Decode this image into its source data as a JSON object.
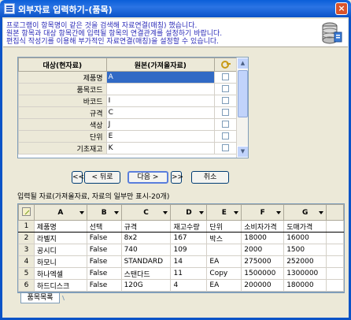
{
  "window": {
    "title": "외부자료 입력하기-(품목)"
  },
  "description": {
    "line1": "프로그램이 항목명이 같은 것을 검색해 자료연결(매칭) 했습니다.",
    "line2": "원본 항목과 대상 항목간에 입력될 항목의 연결관계를 설정하기 바랍니다.",
    "line3": "편집식 작성기를 이용해 부가적인 자료연결(매칭)을 설정할 수 있습니다."
  },
  "mapping": {
    "col_target": "대상(현자료)",
    "col_source": "원본(가져올자료)",
    "rows": [
      {
        "target": "제품명",
        "source": "A",
        "selected": true
      },
      {
        "target": "품목코드",
        "source": "",
        "selected": false
      },
      {
        "target": "바코드",
        "source": "I",
        "selected": false
      },
      {
        "target": "규격",
        "source": "C",
        "selected": false
      },
      {
        "target": "색상",
        "source": "J",
        "selected": false
      },
      {
        "target": "단위",
        "source": "E",
        "selected": false
      },
      {
        "target": "기초재고",
        "source": "K",
        "selected": false
      }
    ]
  },
  "nav": {
    "first": "<<",
    "prev": "< 뒤로",
    "next": "다음 >",
    "last": ">>",
    "cancel": "취소"
  },
  "grid": {
    "caption": "입력될 자료(가져올자료, 자료의 일부만 표시-20개)",
    "columns": [
      "A",
      "B",
      "C",
      "D",
      "E",
      "F",
      "G"
    ],
    "rows": [
      {
        "n": "1",
        "cells": [
          "제품명",
          "선택",
          "규격",
          "재고수량",
          "단위",
          "소비자가격",
          "도매가격"
        ]
      },
      {
        "n": "2",
        "cells": [
          "라벨지",
          "False",
          "8x2",
          "167",
          "박스",
          "18000",
          "16000"
        ]
      },
      {
        "n": "3",
        "cells": [
          "공시디",
          "False",
          "740",
          "109",
          "",
          "2000",
          "1500"
        ]
      },
      {
        "n": "4",
        "cells": [
          "하모니",
          "False",
          "STANDARD",
          "14",
          "EA",
          "275000",
          "252000"
        ]
      },
      {
        "n": "5",
        "cells": [
          "하나엑셀",
          "False",
          "스탠다드",
          "11",
          "Copy",
          "1500000",
          "1300000"
        ]
      },
      {
        "n": "6",
        "cells": [
          "하드디스크",
          "False",
          "120G",
          "4",
          "EA",
          "200000",
          "180000"
        ]
      }
    ]
  },
  "tab": {
    "label": "품목목록"
  }
}
